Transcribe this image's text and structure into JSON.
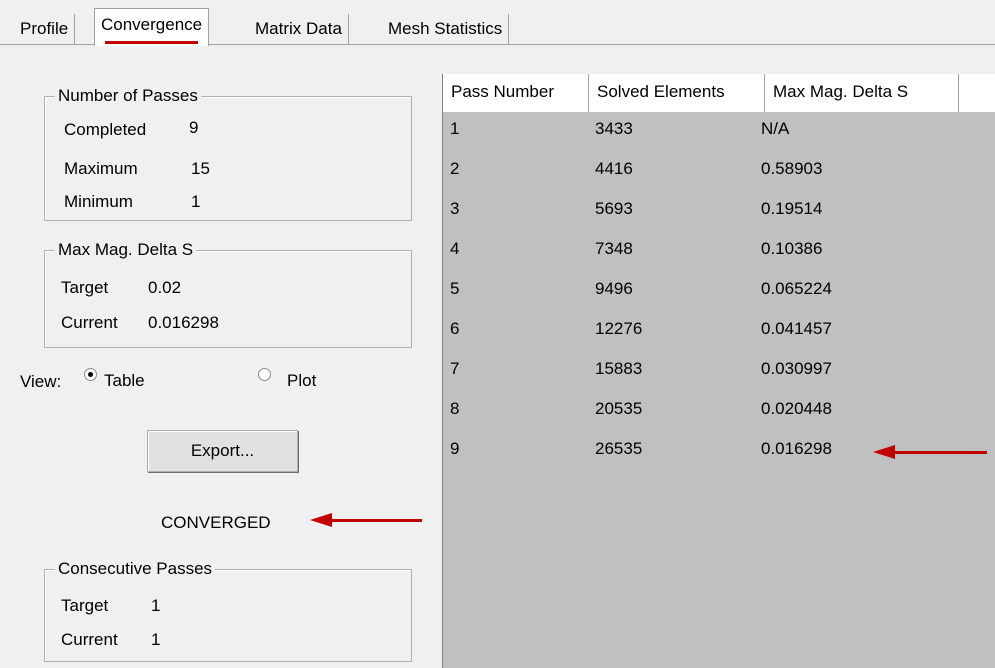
{
  "tabs": [
    {
      "label": "Profile"
    },
    {
      "label": "Convergence"
    },
    {
      "label": "Matrix Data"
    },
    {
      "label": "Mesh Statistics"
    }
  ],
  "number_of_passes": {
    "title": "Number of Passes",
    "completed_label": "Completed",
    "completed_value": "9",
    "maximum_label": "Maximum",
    "maximum_value": "15",
    "minimum_label": "Minimum",
    "minimum_value": "1"
  },
  "max_mag_delta_s": {
    "title": "Max Mag. Delta S",
    "target_label": "Target",
    "target_value": "0.02",
    "current_label": "Current",
    "current_value": "0.016298"
  },
  "view": {
    "label": "View:",
    "table_label": "Table",
    "plot_label": "Plot",
    "selected": "Table"
  },
  "export_label": "Export...",
  "status_text": "CONVERGED",
  "consecutive_passes": {
    "title": "Consecutive Passes",
    "target_label": "Target",
    "target_value": "1",
    "current_label": "Current",
    "current_value": "1"
  },
  "table": {
    "columns": [
      "Pass Number",
      "Solved Elements",
      "Max Mag. Delta S"
    ],
    "rows": [
      [
        "1",
        "3433",
        "N/A"
      ],
      [
        "2",
        "4416",
        "0.58903"
      ],
      [
        "3",
        "5693",
        "0.19514"
      ],
      [
        "4",
        "7348",
        "0.10386"
      ],
      [
        "5",
        "9496",
        "0.065224"
      ],
      [
        "6",
        "12276",
        "0.041457"
      ],
      [
        "7",
        "15883",
        "0.030997"
      ],
      [
        "8",
        "20535",
        "0.020448"
      ],
      [
        "9",
        "26535",
        "0.016298"
      ]
    ]
  },
  "colors": {
    "annotation_red": "#c00000",
    "table_body": "#c0c0c0",
    "panel_bg": "#f0f0f0"
  }
}
